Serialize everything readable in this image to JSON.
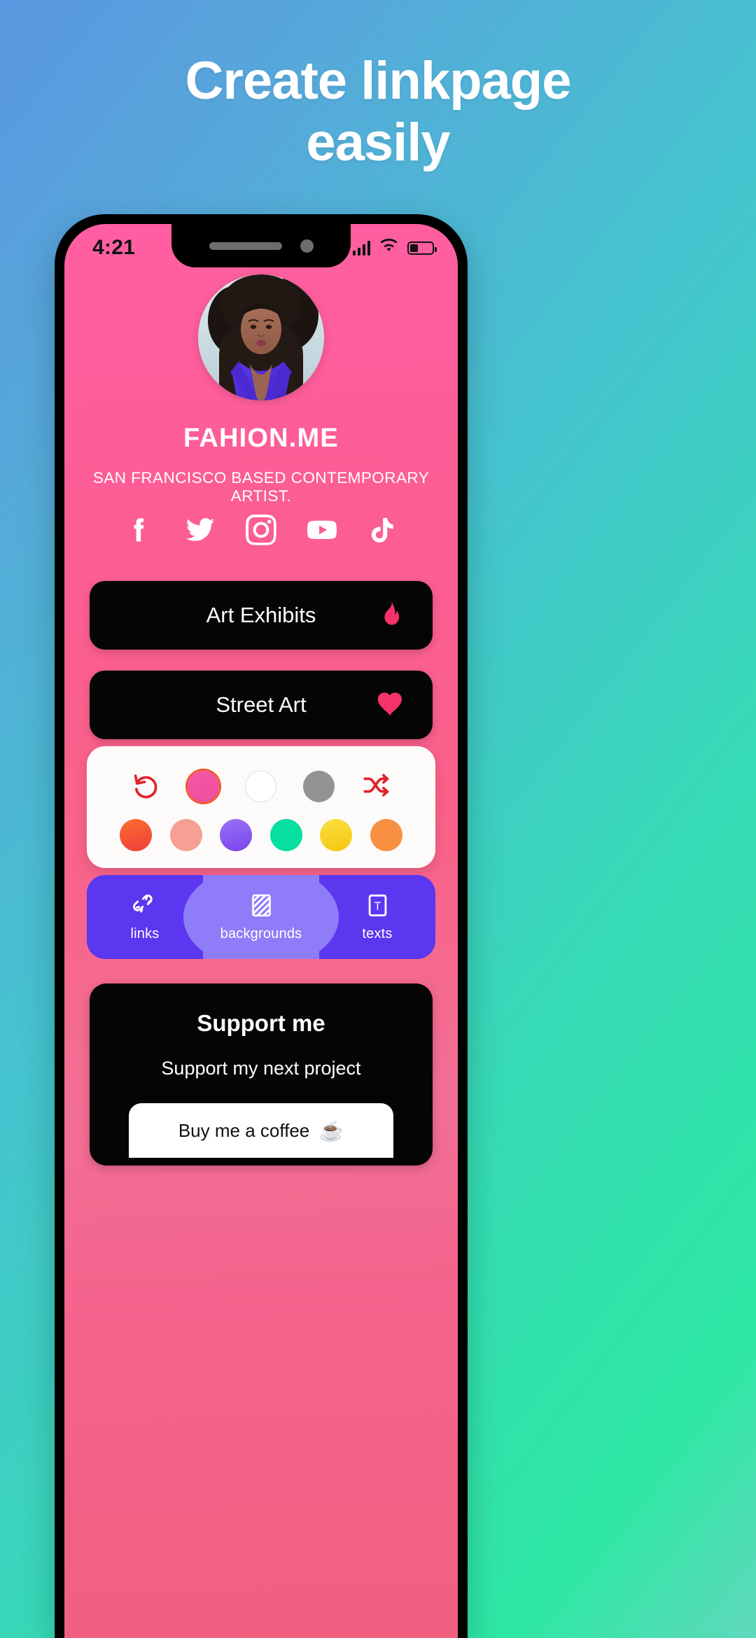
{
  "hero": {
    "headline_line1": "Create linkpage",
    "headline_line2": "easily"
  },
  "colors": {
    "bg_gradient_start": "#5a97e0",
    "bg_gradient_end": "#2ee8a4",
    "screen_pink": "#fc5d93",
    "accent_purple": "#5b37f0",
    "accent_purple_light": "#8f7cf8",
    "link_button_bg": "#050505",
    "flame_pink": "#f4336b",
    "heart_pink": "#f4336b",
    "tool_red": "#e0232a",
    "selected_ring": "#ef5a2a"
  },
  "phone": {
    "status_bar": {
      "time": "4:21",
      "signal_icon": "signal-bars-icon",
      "wifi_icon": "wifi-icon",
      "battery_icon": "battery-low-icon"
    },
    "profile": {
      "avatar_name": "avatar",
      "username": "FAHION.ME",
      "bio": "SAN FRANCISCO BASED CONTEMPORARY ARTIST."
    },
    "socials": [
      {
        "name": "facebook",
        "icon": "facebook-icon"
      },
      {
        "name": "twitter",
        "icon": "twitter-icon"
      },
      {
        "name": "instagram",
        "icon": "instagram-icon"
      },
      {
        "name": "youtube",
        "icon": "youtube-icon"
      },
      {
        "name": "tiktok",
        "icon": "tiktok-icon"
      }
    ],
    "link_buttons": [
      {
        "label": "Art Exhibits",
        "icon": "flame-icon"
      },
      {
        "label": "Street Art",
        "icon": "heart-icon"
      }
    ],
    "editor": {
      "tools_row": [
        {
          "name": "undo",
          "icon": "undo-icon",
          "type": "tool",
          "color": "#e0232a"
        },
        {
          "name": "pink-theme",
          "icon": "color-circle",
          "type": "color",
          "color": "#f2509e",
          "selected": true
        },
        {
          "name": "white-theme",
          "icon": "color-circle",
          "type": "color",
          "color": "#ffffff",
          "selected": false
        },
        {
          "name": "gray-theme",
          "icon": "color-circle",
          "type": "color",
          "color": "#939393",
          "selected": false
        },
        {
          "name": "shuffle",
          "icon": "shuffle-icon",
          "type": "tool",
          "color": "#e0232a"
        }
      ],
      "palette": [
        {
          "name": "orange-red",
          "color": "#f4582f"
        },
        {
          "name": "salmon",
          "color": "#f5a092"
        },
        {
          "name": "purple",
          "color": "#8b5cf0"
        },
        {
          "name": "teal",
          "color": "#06dfa0"
        },
        {
          "name": "yellow",
          "color": "#f7cf0d"
        },
        {
          "name": "orange",
          "color": "#f79141"
        }
      ]
    },
    "tabs": [
      {
        "label": "links",
        "icon": "broken-link-icon",
        "active": false
      },
      {
        "label": "backgrounds",
        "icon": "hatch-pattern-icon",
        "active": true
      },
      {
        "label": "texts",
        "icon": "text-box-icon",
        "active": false
      }
    ],
    "support_card": {
      "title": "Support me",
      "subtitle": "Support my next project",
      "button_label": "Buy me a coffee",
      "button_icon": "coffee-cup-icon",
      "button_emoji": "☕"
    }
  }
}
